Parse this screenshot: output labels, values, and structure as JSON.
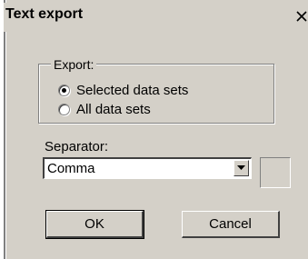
{
  "window": {
    "title": "Text export",
    "close_symbol": "X"
  },
  "export_group": {
    "legend": "Export:",
    "options": [
      {
        "label": "Selected data sets",
        "checked": true
      },
      {
        "label": "All data sets",
        "checked": false
      }
    ]
  },
  "separator": {
    "label": "Separator:",
    "value": "Comma"
  },
  "buttons": {
    "ok": "OK",
    "cancel": "Cancel"
  }
}
